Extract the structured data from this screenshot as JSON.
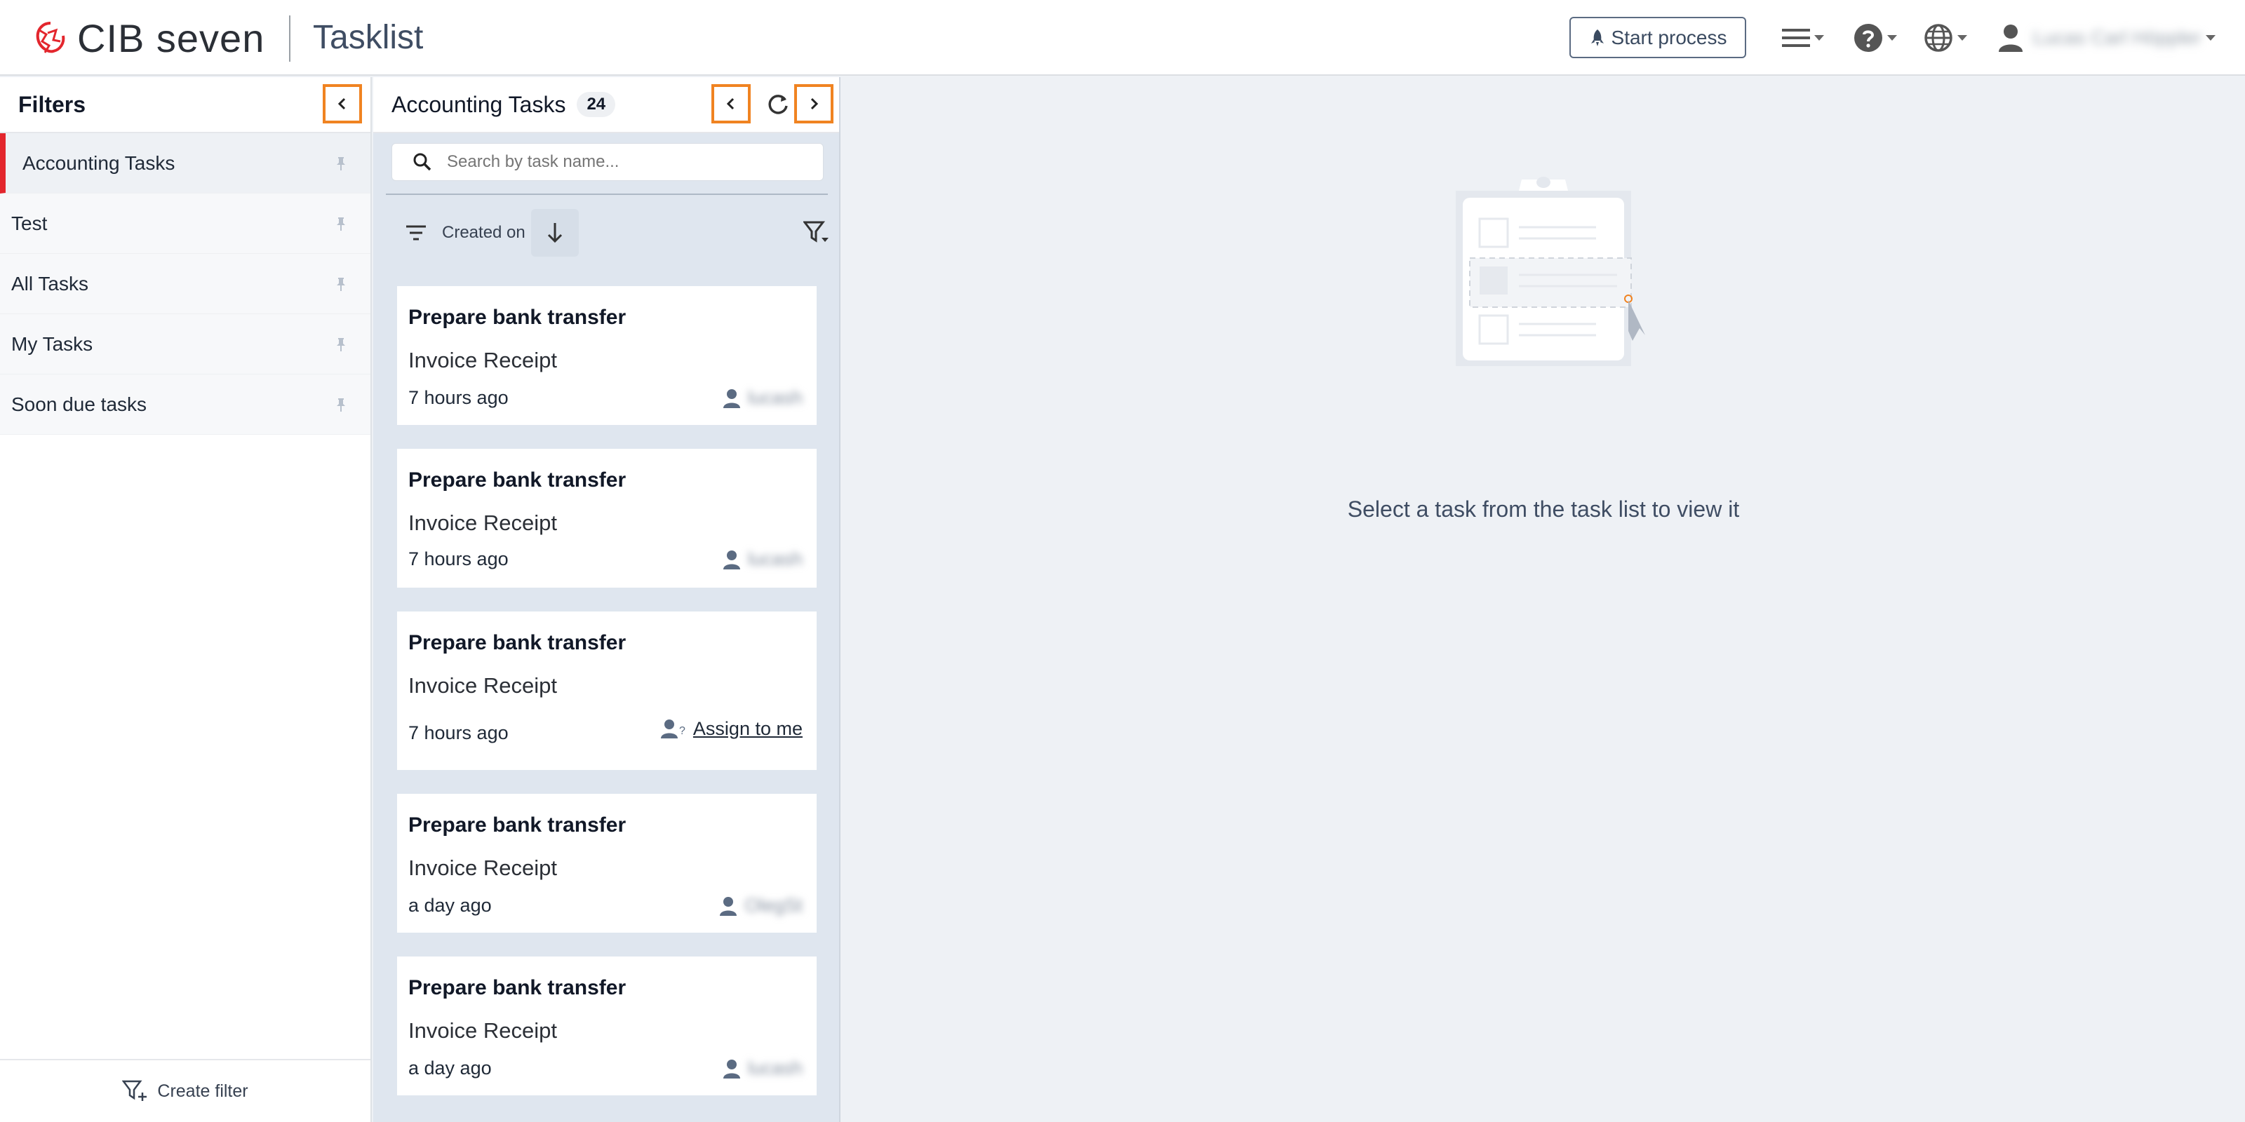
{
  "header": {
    "brand_name": "CIB seven",
    "app_title": "Tasklist",
    "start_process_label": "Start process",
    "user_name": "Lucas Carl Höppler"
  },
  "filters": {
    "title": "Filters",
    "items": [
      {
        "label": "Accounting Tasks",
        "active": true
      },
      {
        "label": "Test",
        "active": false
      },
      {
        "label": "All Tasks",
        "active": false
      },
      {
        "label": "My Tasks",
        "active": false
      },
      {
        "label": "Soon due tasks",
        "active": false
      }
    ],
    "create_filter_label": "Create filter"
  },
  "tasklist": {
    "title": "Accounting Tasks",
    "count": "24",
    "search_placeholder": "Search by task name...",
    "sort_label": "Created on",
    "tasks": [
      {
        "name": "Prepare bank transfer",
        "process": "Invoice Receipt",
        "time": "7 hours ago",
        "assignee": "lucash",
        "action": ""
      },
      {
        "name": "Prepare bank transfer",
        "process": "Invoice Receipt",
        "time": "7 hours ago",
        "assignee": "lucash",
        "action": ""
      },
      {
        "name": "Prepare bank transfer",
        "process": "Invoice Receipt",
        "time": "7 hours ago",
        "assignee": "",
        "action": "Assign to me"
      },
      {
        "name": "Prepare bank transfer",
        "process": "Invoice Receipt",
        "time": "a day ago",
        "assignee": "OlegSt",
        "action": ""
      },
      {
        "name": "Prepare bank transfer",
        "process": "Invoice Receipt",
        "time": "a day ago",
        "assignee": "lucash",
        "action": ""
      }
    ]
  },
  "detail": {
    "empty_message": "Select a task from the task list to view it"
  },
  "colors": {
    "accent_red": "#e3262d",
    "highlight_orange": "#f08321",
    "text_slate": "#3f4d63"
  }
}
